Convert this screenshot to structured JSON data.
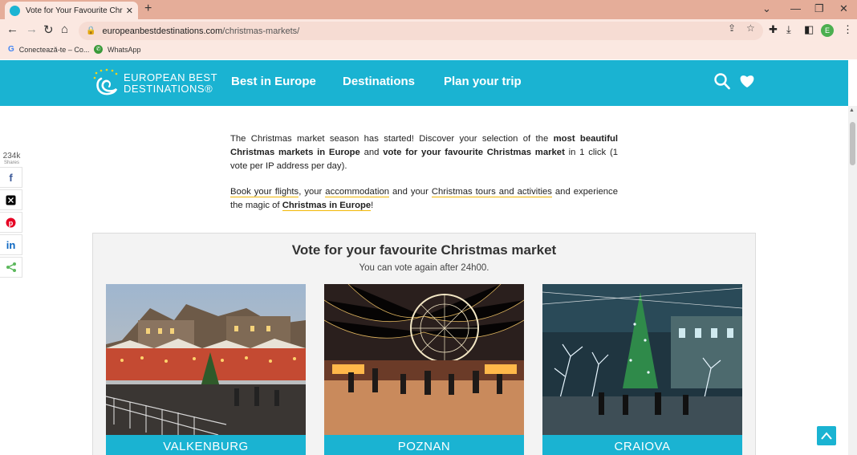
{
  "browser": {
    "tab_title": "Vote for Your Favourite Christmas",
    "url_domain": "europeanbestdestinations.com",
    "url_path": "/christmas-markets/",
    "profile_initial": "E",
    "bookmarks": [
      {
        "label": "Conectează-te – Co...",
        "icon": "google-icon"
      },
      {
        "label": "WhatsApp",
        "icon": "whatsapp-icon"
      }
    ]
  },
  "site": {
    "logo_line1": "EUROPEAN BEST",
    "logo_line2": "DESTINATIONS®",
    "nav": [
      "Best in Europe",
      "Destinations",
      "Plan your trip"
    ],
    "brand_color": "#1ab3d2"
  },
  "share": {
    "count": "234k",
    "count_label": "Shares",
    "buttons": [
      "facebook-icon",
      "x-icon",
      "pinterest-icon",
      "linkedin-icon",
      "share-icon"
    ]
  },
  "intro": {
    "p1_a": "The Christmas market season has started! Discover your selection of the ",
    "p1_b": "most beautiful Christmas markets in Europe",
    "p1_c": " and ",
    "p1_d": "vote for your favourite Christmas market",
    "p1_e": " in 1 click (1 vote per IP address per day).",
    "p2_link1": "Book your flights",
    "p2_a": ", your ",
    "p2_link2": "accommodation",
    "p2_b": " and your ",
    "p2_link3": "Christmas tours and activities",
    "p2_c": " and experience the magic of ",
    "p2_link4": "Christmas in Europe",
    "p2_d": "!"
  },
  "vote": {
    "title": "Vote for your favourite Christmas market",
    "subtitle": "You can vote again after 24h00.",
    "markets": [
      {
        "name": "VALKENBURG"
      },
      {
        "name": "POZNAN"
      },
      {
        "name": "CRAIOVA"
      }
    ]
  }
}
